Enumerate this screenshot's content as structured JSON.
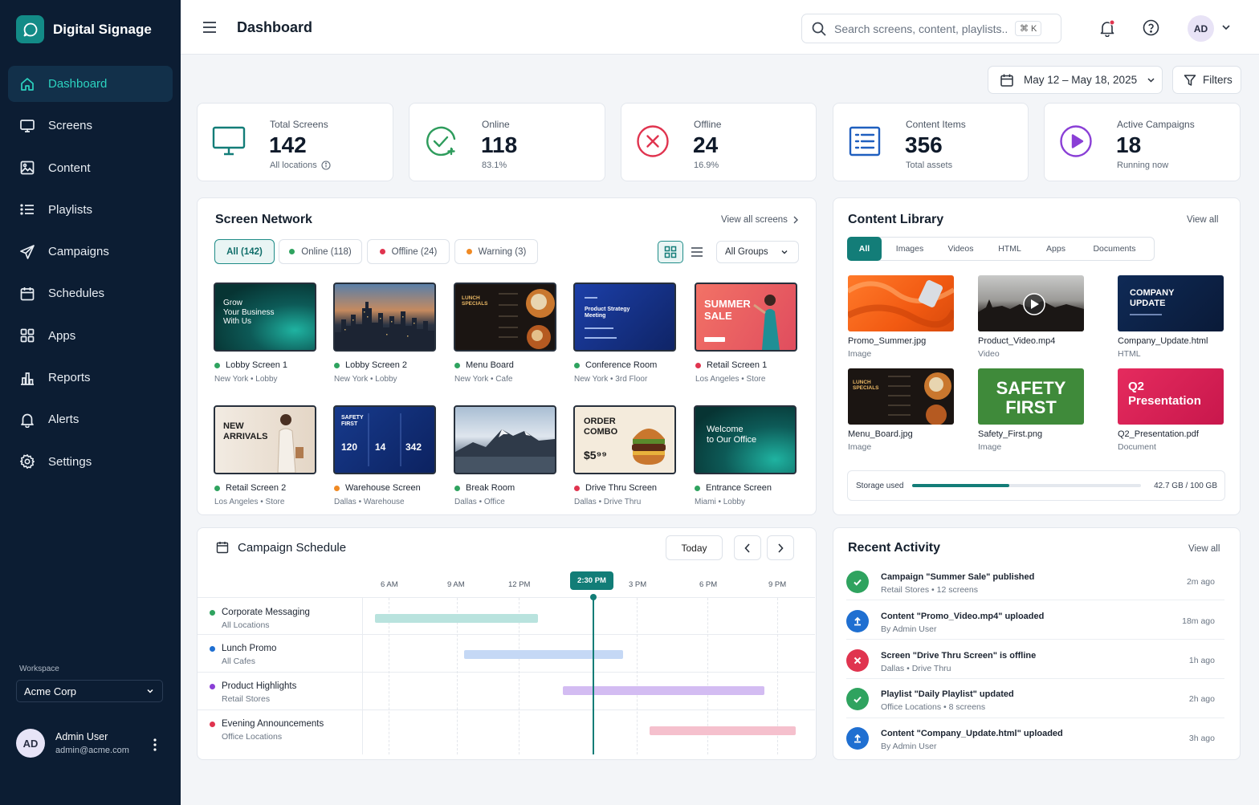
{
  "app": {
    "name": "Digital Signage"
  },
  "nav": [
    {
      "label": "Dashboard",
      "icon": "home-icon",
      "active": true
    },
    {
      "label": "Screens",
      "icon": "monitor-icon"
    },
    {
      "label": "Content",
      "icon": "image-icon"
    },
    {
      "label": "Playlists",
      "icon": "list-icon"
    },
    {
      "label": "Campaigns",
      "icon": "send-icon"
    },
    {
      "label": "Schedules",
      "icon": "calendar-icon"
    },
    {
      "label": "Apps",
      "icon": "grid-icon"
    },
    {
      "label": "Reports",
      "icon": "bar-chart-icon"
    },
    {
      "label": "Alerts",
      "icon": "bell-icon"
    },
    {
      "label": "Settings",
      "icon": "gear-icon"
    }
  ],
  "workspace": {
    "label": "Workspace",
    "value": "Acme Corp"
  },
  "user": {
    "initials": "AD",
    "name": "Admin User",
    "email": "admin@acme.com"
  },
  "header": {
    "title": "Dashboard",
    "search_placeholder": "Search screens, content, playlists...",
    "shortcut": "⌘ K",
    "avatar": "AD"
  },
  "filters": {
    "date_range": "May 12 – May 18, 2025",
    "filters_label": "Filters"
  },
  "stats": [
    {
      "label": "Total Screens",
      "value": "142",
      "sub": "All locations",
      "color": "#137d78"
    },
    {
      "label": "Online",
      "value": "118",
      "sub": "83.1%",
      "color": "#2e9c5c"
    },
    {
      "label": "Offline",
      "value": "24",
      "sub": "16.9%",
      "color": "#e0344f"
    },
    {
      "label": "Content Items",
      "value": "356",
      "sub": "Total assets",
      "color": "#1f5fbf"
    },
    {
      "label": "Active Campaigns",
      "value": "18",
      "sub": "Running now",
      "color": "#8a3fd6"
    }
  ],
  "screen_network": {
    "title": "Screen Network",
    "view_all": "View all screens",
    "chips": [
      {
        "label": "All (142)"
      },
      {
        "label": "Online (118)",
        "color": "#2fa35f"
      },
      {
        "label": "Offline (24)",
        "color": "#e0344f"
      },
      {
        "label": "Warning (3)",
        "color": "#f08a24"
      }
    ],
    "group_select": "All Groups",
    "screens": [
      {
        "name": "Lobby Screen 1",
        "loc": "New York • Lobby",
        "status": "#2fa35f",
        "thumb_text": "Grow\nYour Business\nWith Us"
      },
      {
        "name": "Lobby Screen 2",
        "loc": "New York • Lobby",
        "status": "#2fa35f"
      },
      {
        "name": "Menu Board",
        "loc": "New York • Cafe",
        "status": "#2fa35f",
        "thumb_text": "LUNCH\nSPECIALS"
      },
      {
        "name": "Conference Room",
        "loc": "New York • 3rd Floor",
        "status": "#2fa35f",
        "thumb_text": "Product Strategy\nMeeting"
      },
      {
        "name": "Retail Screen 1",
        "loc": "Los Angeles • Store",
        "status": "#e0344f",
        "thumb_text": "SUMMER\nSALE"
      },
      {
        "name": "Retail Screen 2",
        "loc": "Los Angeles • Store",
        "status": "#2fa35f",
        "thumb_text": "NEW\nARRIVALS"
      },
      {
        "name": "Warehouse Screen",
        "loc": "Dallas • Warehouse",
        "status": "#f08a24",
        "thumb_text": "SAFETY\nFIRST"
      },
      {
        "name": "Break Room",
        "loc": "Dallas • Office",
        "status": "#2fa35f"
      },
      {
        "name": "Drive Thru Screen",
        "loc": "Dallas • Drive Thru",
        "status": "#e0344f",
        "thumb_text": "ORDER\nCOMBO"
      },
      {
        "name": "Entrance Screen",
        "loc": "Miami • Lobby",
        "status": "#2fa35f",
        "thumb_text": "Welcome\nto Our Office"
      }
    ],
    "thumb_extras": {
      "safety_nums": [
        "120",
        "14",
        "342"
      ],
      "price": "$5⁹⁹"
    }
  },
  "content_library": {
    "title": "Content Library",
    "view_all": "View all",
    "tabs": [
      "All",
      "Images",
      "Videos",
      "HTML",
      "Apps",
      "Documents"
    ],
    "items": [
      {
        "name": "Promo_Summer.jpg",
        "type": "Image"
      },
      {
        "name": "Product_Video.mp4",
        "type": "Video"
      },
      {
        "name": "Company_Update.html",
        "type": "HTML",
        "thumb_text": "COMPANY\nUPDATE"
      },
      {
        "name": "Menu_Board.jpg",
        "type": "Image",
        "thumb_text": "LUNCH\nSPECIALS"
      },
      {
        "name": "Safety_First.png",
        "type": "Image",
        "thumb_text": "SAFETY\nFIRST"
      },
      {
        "name": "Q2_Presentation.pdf",
        "type": "Document",
        "thumb_text": "Q2\nPresentation"
      }
    ],
    "storage": {
      "label": "Storage used",
      "value": "42.7 GB / 100 GB",
      "fraction": 0.427
    }
  },
  "campaign_schedule": {
    "title": "Campaign Schedule",
    "today": "Today",
    "now": "2:30 PM",
    "times": [
      "6 AM",
      "9 AM",
      "12 PM",
      "3 PM",
      "6 PM",
      "9 PM"
    ],
    "rows": [
      {
        "name": "Corporate Messaging",
        "loc": "All Locations",
        "color": "#2fa35f",
        "bar": "#b9e3de"
      },
      {
        "name": "Lunch Promo",
        "loc": "All Cafes",
        "color": "#1f6fd1",
        "bar": "#c5d8f5"
      },
      {
        "name": "Product Highlights",
        "loc": "Retail Stores",
        "color": "#8a3fd6",
        "bar": "#d3bcf2"
      },
      {
        "name": "Evening Announcements",
        "loc": "Office Locations",
        "color": "#e0344f",
        "bar": "#f5c0cd"
      }
    ]
  },
  "recent_activity": {
    "title": "Recent Activity",
    "view_all": "View all",
    "items": [
      {
        "title": "Campaign \"Summer Sale\" published",
        "sub": "Retail Stores • 12 screens",
        "time": "2m ago",
        "kind": "check",
        "color": "#2fa35f"
      },
      {
        "title": "Content \"Promo_Video.mp4\" uploaded",
        "sub": "By Admin User",
        "time": "18m ago",
        "kind": "upload",
        "color": "#1f6fd1"
      },
      {
        "title": "Screen \"Drive Thru Screen\" is offline",
        "sub": "Dallas • Drive Thru",
        "time": "1h ago",
        "kind": "x",
        "color": "#e0344f"
      },
      {
        "title": "Playlist \"Daily Playlist\" updated",
        "sub": "Office Locations • 8 screens",
        "time": "2h ago",
        "kind": "check",
        "color": "#2fa35f"
      },
      {
        "title": "Content \"Company_Update.html\" uploaded",
        "sub": "By Admin User",
        "time": "3h ago",
        "kind": "upload",
        "color": "#1f6fd1"
      }
    ]
  }
}
